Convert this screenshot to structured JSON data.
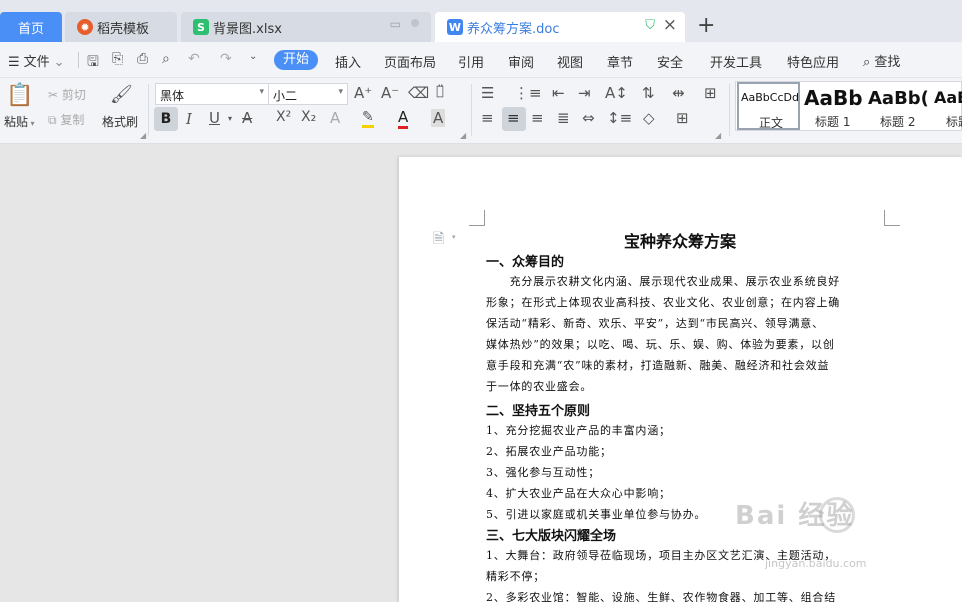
{
  "tabs": {
    "home": "首页",
    "daoke": "稻壳模板",
    "xlsx": "背景图.xlsx",
    "doc": "养众筹方案.doc",
    "s_icon": "S",
    "w_icon": "W",
    "new_tab": "+"
  },
  "menu": {
    "file": "文件",
    "items": [
      "开始",
      "插入",
      "页面布局",
      "引用",
      "审阅",
      "视图",
      "章节",
      "安全",
      "开发工具",
      "特色应用"
    ],
    "search": "查找"
  },
  "ribbon": {
    "paste": "粘贴",
    "cut": "剪切",
    "copy": "复制",
    "format_painter": "格式刷",
    "font_name": "黑体",
    "font_size": "小二",
    "bold": "B",
    "italic": "I",
    "underline": "U",
    "styles": [
      {
        "sample": "AaBbCcDd",
        "name": "正文"
      },
      {
        "sample": "AaBb",
        "name": "标题 1"
      },
      {
        "sample": "AaBb(",
        "name": "标题 2"
      },
      {
        "sample": "AaE",
        "name": "标题"
      }
    ]
  },
  "document": {
    "title": "宝种养众筹方案",
    "lines": [
      {
        "text": "一、众筹目的",
        "heading": true
      },
      {
        "text": "　　充分展示农耕文化内涵、展示现代农业成果、展示农业系统良好",
        "heading": false
      },
      {
        "text": "形象；在形式上体现农业高科技、农业文化、农业创意；在内容上确",
        "heading": false
      },
      {
        "text": "保活动“精彩、新奇、欢乐、平安”，达到“市民高兴、领导满意、",
        "heading": false
      },
      {
        "text": "媒体热炒”的效果；以吃、喝、玩、乐、娱、购、体验为要素，以创",
        "heading": false
      },
      {
        "text": "意手段和充满“农”味的素材，打造融新、融美、融经济和社会效益",
        "heading": false
      },
      {
        "text": "于一体的农业盛会。",
        "heading": false
      },
      {
        "text": "二、坚持五个原则",
        "heading": true
      },
      {
        "text": "1、充分挖掘农业产品的丰富内涵；",
        "heading": false
      },
      {
        "text": "2、拓展农业产品功能；",
        "heading": false
      },
      {
        "text": "3、强化参与互动性；",
        "heading": false
      },
      {
        "text": "4、扩大农业产品在大众心中影响；",
        "heading": false
      },
      {
        "text": "5、引进以家庭或机关事业单位参与协办。",
        "heading": false
      },
      {
        "text": "三、七大版块闪耀全场",
        "heading": true
      },
      {
        "text": "1、大舞台：政府领导莅临现场，项目主办区文艺汇演、主题活动，",
        "heading": false
      },
      {
        "text": "精彩不停；",
        "heading": false
      },
      {
        "text": "2、多彩农业馆：智能、设施、生鲜、农作物食器、加工等、组合结",
        "heading": false
      }
    ]
  },
  "watermark": {
    "main": "Bai  经验",
    "url": "jingyan.baidu.com"
  },
  "colors": {
    "accent": "#4a8ff5",
    "tab_bg": "#e4e7ee",
    "toolbar_bg": "#f3f4f7"
  }
}
